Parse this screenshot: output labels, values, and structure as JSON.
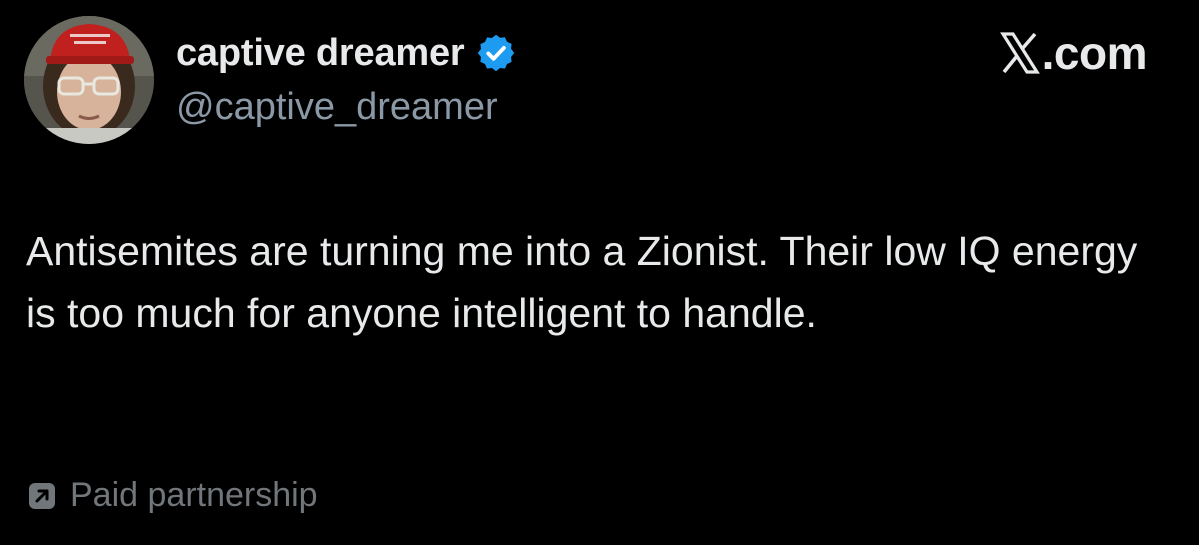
{
  "author": {
    "display_name": "captive dreamer",
    "handle": "@captive_dreamer",
    "verified": true,
    "avatar_icon": "profile-photo-red-cap"
  },
  "brand": {
    "text": ".com",
    "logo_icon": "x-logo-icon"
  },
  "tweet": {
    "text": "Antisemites are turning me into a Zionist. Their low IQ energy is too much for anyone intelligent to handle."
  },
  "footer": {
    "paid_label": "Paid partnership",
    "paid_icon": "arrow-up-right-box-icon"
  },
  "colors": {
    "background": "#000000",
    "primary_text": "#e7e9ea",
    "secondary_text": "#8b98a5",
    "muted_text": "#71767b",
    "verified_blue": "#1d9bf0"
  }
}
